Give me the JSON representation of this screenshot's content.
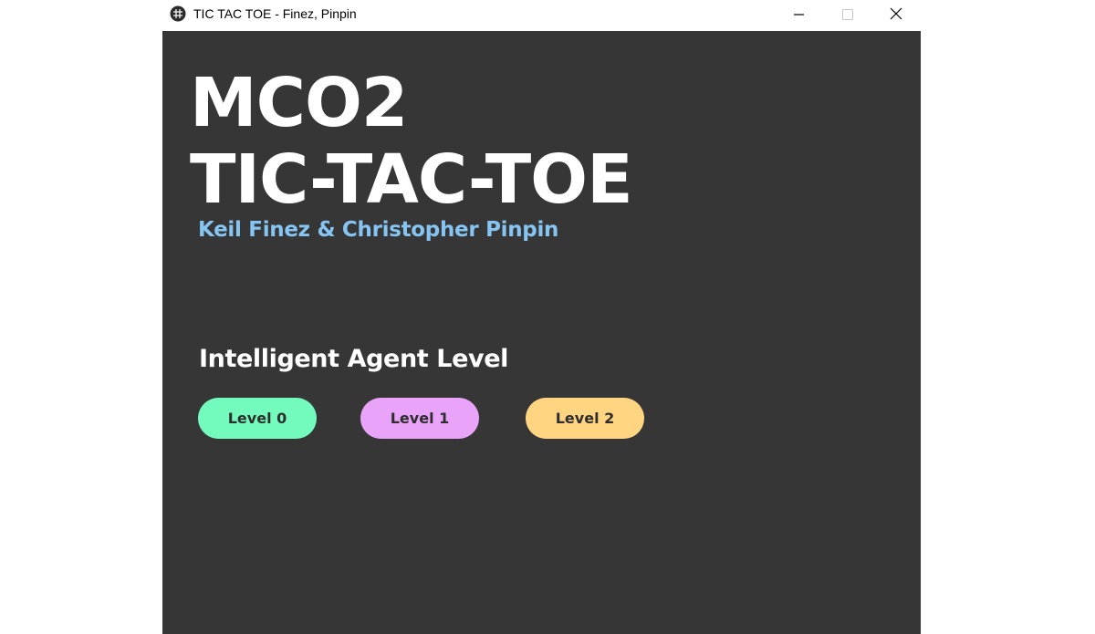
{
  "window": {
    "title": "TIC TAC TOE - Finez, Pinpin",
    "app_icon": "app-icon",
    "controls": {
      "minimize_icon": "minimize-icon",
      "maximize_icon": "maximize-icon",
      "close_icon": "close-icon"
    }
  },
  "main": {
    "heading_line1": "MCO2",
    "heading_line2": "TIC-TAC-TOE",
    "authors": "Keil Finez & Christopher Pinpin",
    "level_section": {
      "label": "Intelligent Agent Level",
      "buttons": [
        {
          "label": "Level 0",
          "color": "#72fbbc"
        },
        {
          "label": "Level 1",
          "color": "#e9a3f9"
        },
        {
          "label": "Level 2",
          "color": "#ffd581"
        }
      ]
    }
  },
  "colors": {
    "background": "#363636",
    "heading": "#ffffff",
    "authors": "#86c5f2"
  }
}
